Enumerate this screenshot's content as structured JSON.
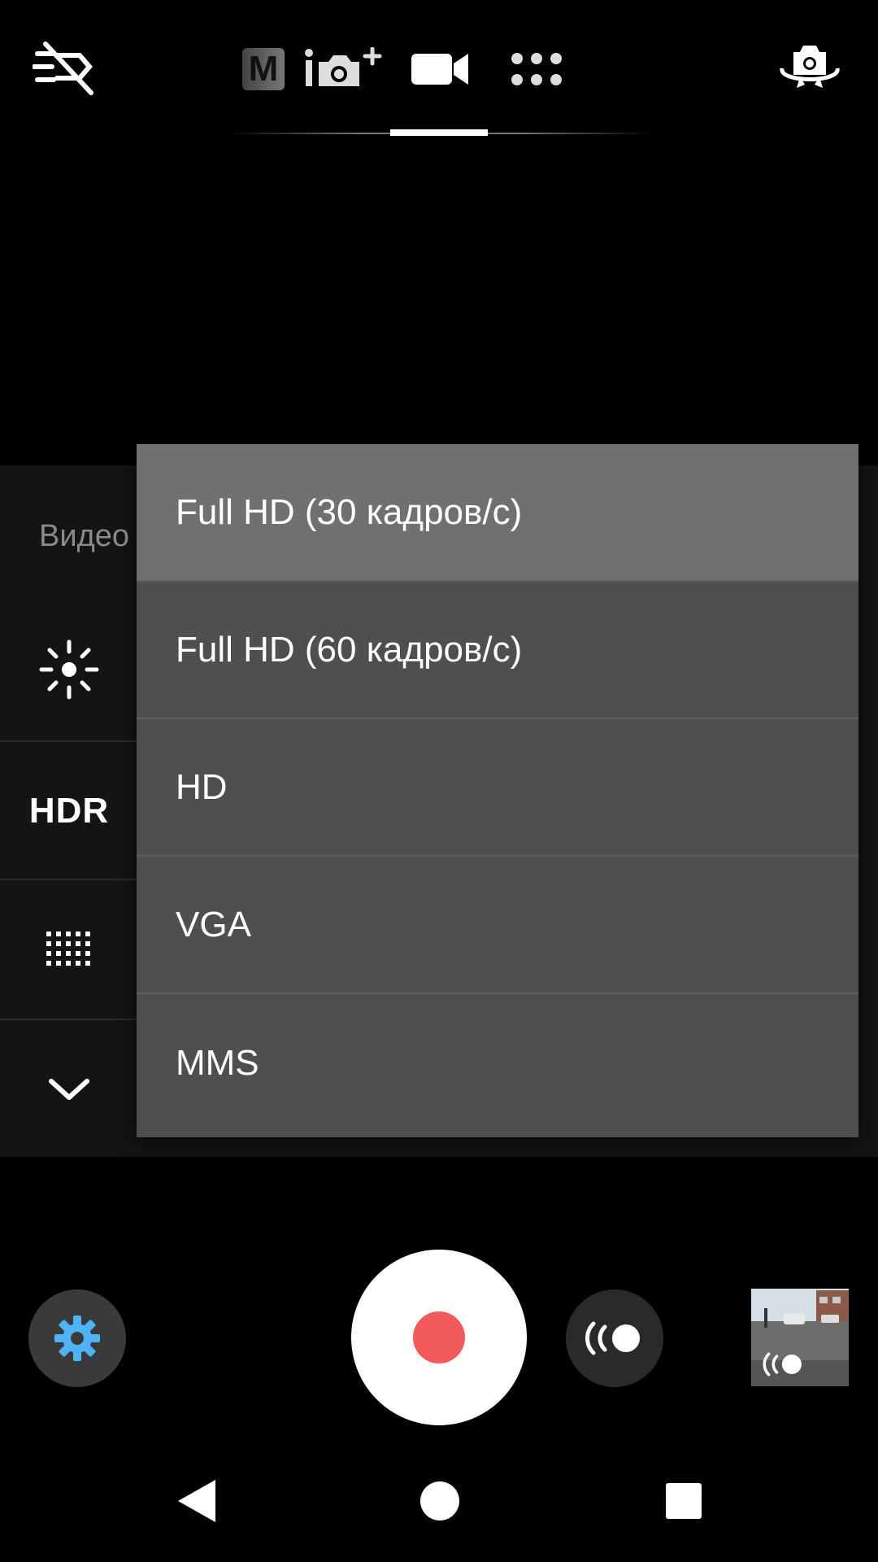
{
  "top_bar": {
    "icons": {
      "flash": "flash-off-icon",
      "manual_mode": "manual-mode-icon",
      "superior_auto": "superior-auto-icon",
      "video_mode": "video-camera-icon",
      "apps": "apps-grid-icon",
      "switch_camera": "switch-camera-icon"
    },
    "manual_label": "M",
    "active_mode": "video"
  },
  "settings_panel": {
    "title": "Видео",
    "hdr_label": "HDR",
    "icons": [
      "brightness-icon",
      "hdr-icon",
      "grid-icon",
      "chevron-down-icon"
    ]
  },
  "dropdown": {
    "items": [
      {
        "label": "Full HD (30 кадров/с)",
        "selected": true
      },
      {
        "label": "Full HD (60 кадров/с)",
        "selected": false
      },
      {
        "label": "HD",
        "selected": false
      },
      {
        "label": "VGA",
        "selected": false
      },
      {
        "label": "MMS",
        "selected": false
      }
    ]
  },
  "bottom_controls": {
    "settings_icon": "gear-icon",
    "record_icon": "record-icon",
    "steadyshot_icon": "steadyshot-icon",
    "thumbnail": "last-capture-thumbnail"
  },
  "colors": {
    "accent": "#4fb3f6",
    "record": "#f35b5b",
    "selected_item": "#707070",
    "dropdown_bg": "#4f4f4f"
  },
  "nav_bar": {
    "icons": [
      "back-icon",
      "home-icon",
      "recents-icon"
    ]
  }
}
